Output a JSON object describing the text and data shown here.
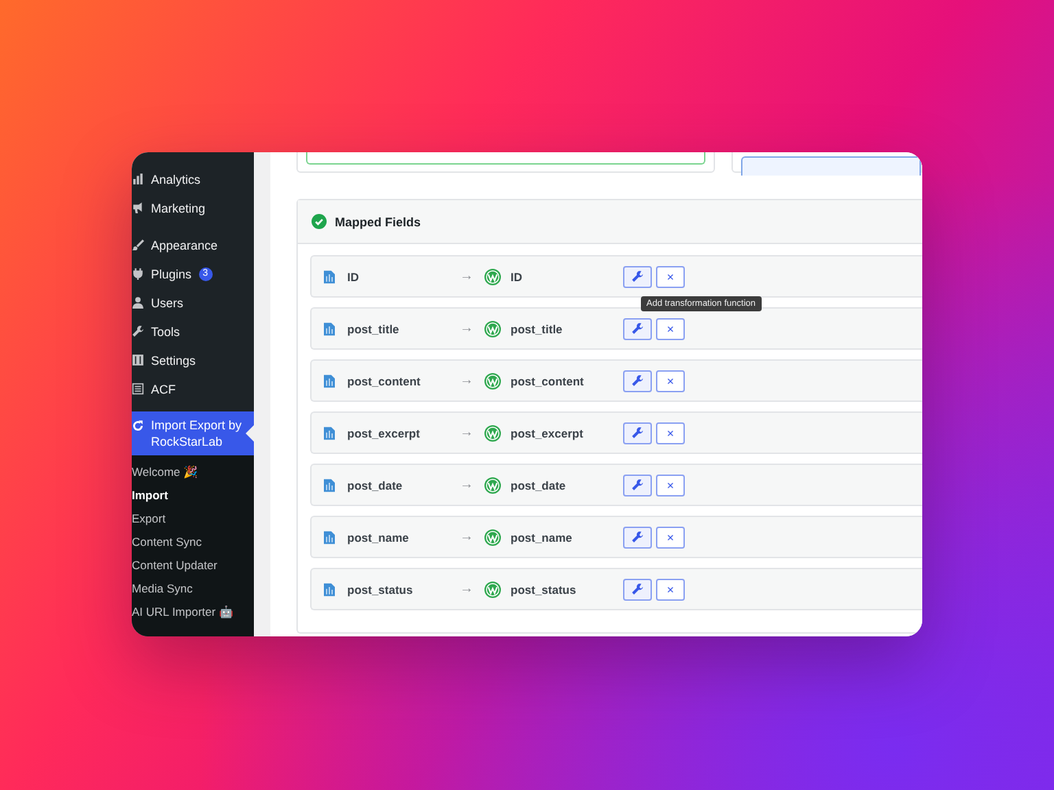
{
  "sidebar": {
    "items": [
      {
        "label": "Analytics",
        "selected": false
      },
      {
        "label": "Marketing",
        "selected": false
      },
      {
        "label": "Appearance",
        "selected": false,
        "gap": true
      },
      {
        "label": "Plugins",
        "selected": false,
        "badge": "3"
      },
      {
        "label": "Users",
        "selected": false
      },
      {
        "label": "Tools",
        "selected": false
      },
      {
        "label": "Settings",
        "selected": false
      },
      {
        "label": "ACF",
        "selected": false
      },
      {
        "label": "Import Export by RockStarLab",
        "selected": true
      }
    ],
    "submenu": [
      {
        "label": "Welcome 🎉",
        "selected": false
      },
      {
        "label": "Import",
        "selected": true
      },
      {
        "label": "Export",
        "selected": false
      },
      {
        "label": "Content Sync",
        "selected": false
      },
      {
        "label": "Content Updater",
        "selected": false
      },
      {
        "label": "Media Sync",
        "selected": false
      },
      {
        "label": "AI URL Importer 🤖",
        "selected": false
      }
    ]
  },
  "mapped_fields": {
    "title": "Mapped Fields",
    "rows": [
      {
        "source": "ID",
        "arrow": "→",
        "target": "ID"
      },
      {
        "source": "post_title",
        "arrow": "→",
        "target": "post_title"
      },
      {
        "source": "post_content",
        "arrow": "→",
        "target": "post_content"
      },
      {
        "source": "post_excerpt",
        "arrow": "→",
        "target": "post_excerpt"
      },
      {
        "source": "post_date",
        "arrow": "→",
        "target": "post_date"
      },
      {
        "source": "post_name",
        "arrow": "→",
        "target": "post_name"
      },
      {
        "source": "post_status",
        "arrow": "→",
        "target": "post_status"
      }
    ],
    "remove_label": "×",
    "tooltip": "Add transformation function"
  }
}
